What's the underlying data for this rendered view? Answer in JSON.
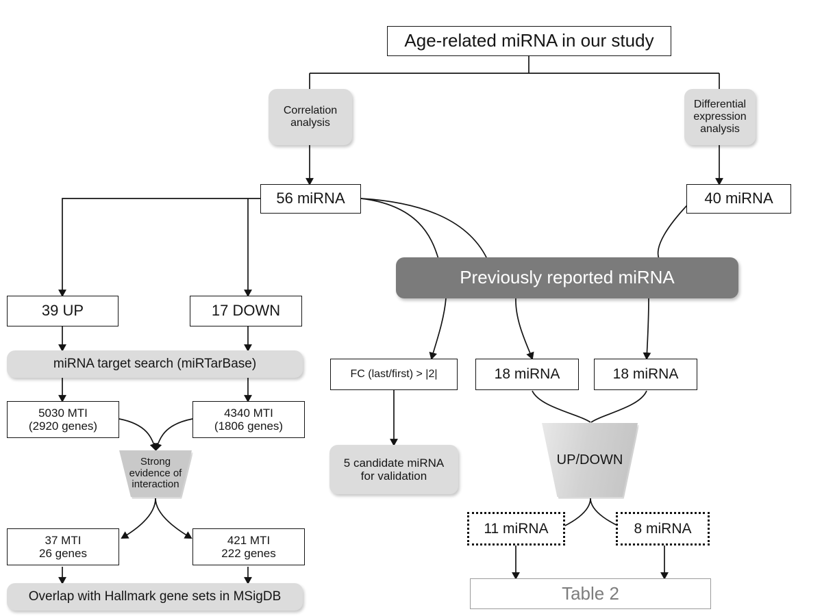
{
  "diagram": {
    "title": "Age-related miRNA study flowchart",
    "colors": {
      "page_background": "#ffffff",
      "rect_border": "#141414",
      "pill_fill": "#dcdcdc",
      "dark_bar_fill": "#7b7b7b",
      "dark_bar_text": "#ffffff",
      "trapezoid_fill": "#c9c9c9",
      "table_ref_text": "#7d7d7d",
      "table_ref_border": "#9a9a9a",
      "edge_stroke": "#141414"
    },
    "nodes": {
      "root": {
        "label": "Age-related  miRNA in our study",
        "shape": "rect"
      },
      "correlation_analysis": {
        "label": "Correlation\nanalysis",
        "shape": "pill"
      },
      "differential_expression_analysis": {
        "label": "Differential\nexpression\nanalysis",
        "shape": "pill"
      },
      "mirna_56": {
        "label": "56 miRNA",
        "shape": "rect"
      },
      "mirna_40": {
        "label": "40 miRNA",
        "shape": "rect"
      },
      "up_39": {
        "label": "39 UP",
        "shape": "rect"
      },
      "down_17": {
        "label": "17 DOWN",
        "shape": "rect"
      },
      "target_search": {
        "label": "miRNA target search (miRTarBase)",
        "shape": "pill"
      },
      "mti_5030": {
        "label": "5030 MTI\n(2920 genes)",
        "shape": "rect"
      },
      "mti_4340": {
        "label": "4340 MTI\n(1806 genes)",
        "shape": "rect"
      },
      "strong_evidence": {
        "label": "Strong\nevidence of\ninteraction",
        "shape": "trapezoid"
      },
      "mti_37": {
        "label": "37 MTI\n26 genes",
        "shape": "rect"
      },
      "mti_421": {
        "label": "421  MTI\n222 genes",
        "shape": "rect"
      },
      "overlap_hallmark": {
        "label": "Overlap with Hallmark gene sets in MSigDB",
        "shape": "pill"
      },
      "previously_reported": {
        "label": "Previously reported  miRNA",
        "shape": "dark-bar"
      },
      "fold_change_filter": {
        "label": "FC (last/first) > |2|",
        "shape": "rect"
      },
      "mirna_18_left": {
        "label": "18 miRNA",
        "shape": "rect"
      },
      "mirna_18_right": {
        "label": "18 miRNA",
        "shape": "rect"
      },
      "candidate_5": {
        "label": "5 candidate miRNA\nfor validation",
        "shape": "pill"
      },
      "up_down": {
        "label": "UP/DOWN",
        "shape": "trapezoid"
      },
      "mirna_11": {
        "label": "11 miRNA",
        "shape": "dotted-rect"
      },
      "mirna_8": {
        "label": "8 miRNA",
        "shape": "dotted-rect"
      },
      "table_ref": {
        "label": "Table 2",
        "shape": "rect-gray"
      }
    }
  }
}
